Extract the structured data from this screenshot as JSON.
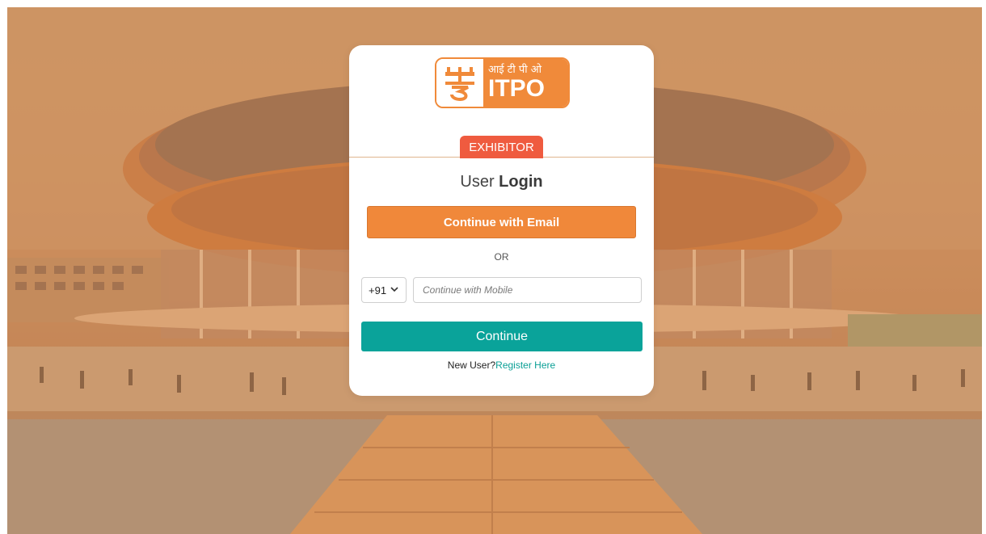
{
  "logo": {
    "hindi_text": "आई टी पी ओ",
    "brand": "ITPO",
    "icon": "itpo-emblem-icon",
    "brand_color": "#f08a3a"
  },
  "login": {
    "role_badge": "EXHIBITOR",
    "title_prefix": "User",
    "title_emphasis": "Login",
    "email_button": "Continue with Email",
    "separator": "OR",
    "country_code": "+91",
    "mobile_placeholder": "Continue with Mobile",
    "continue_button": "Continue",
    "new_user_text": "New User?",
    "register_link": "Register Here"
  },
  "colors": {
    "email_button": "#f0883a",
    "continue_button": "#0aa39a",
    "badge": "#ef5b3f",
    "link": "#0a9f95"
  }
}
